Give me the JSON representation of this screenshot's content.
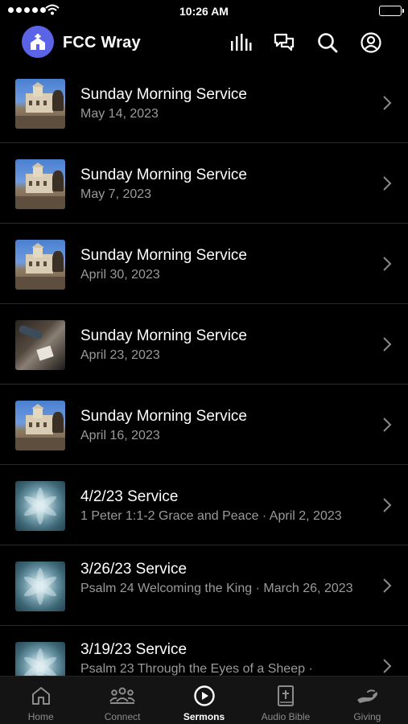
{
  "status_bar": {
    "time": "10:26 AM"
  },
  "header": {
    "app_title": "FCC Wray"
  },
  "sermons": [
    {
      "title": "Sunday Morning Service",
      "subtitle": "May 14, 2023",
      "thumbnail": "church-building-photo"
    },
    {
      "title": "Sunday Morning Service",
      "subtitle": "May 7, 2023",
      "thumbnail": "church-building-photo"
    },
    {
      "title": "Sunday Morning Service",
      "subtitle": "April 30, 2023",
      "thumbnail": "church-building-photo"
    },
    {
      "title": "Sunday Morning Service",
      "subtitle": "April 23, 2023",
      "thumbnail": "people-reading-photo"
    },
    {
      "title": "Sunday Morning Service",
      "subtitle": "April 16, 2023",
      "thumbnail": "church-building-photo"
    },
    {
      "title": "4/2/23 Service",
      "subtitle": "1 Peter 1:1-2 Grace and Peace · April 2, 2023",
      "thumbnail": "succulent-photo"
    },
    {
      "title": "3/26/23 Service",
      "subtitle": "Psalm 24 Welcoming the King · March 26, 2023",
      "thumbnail": "succulent-photo"
    },
    {
      "title": "3/19/23 Service",
      "subtitle": "Psalm 23 Through the Eyes of a Sheep ·",
      "thumbnail": "succulent-photo"
    }
  ],
  "tabs": [
    {
      "label": "Home",
      "icon": "home-icon",
      "active": false
    },
    {
      "label": "Connect",
      "icon": "group-icon",
      "active": false
    },
    {
      "label": "Sermons",
      "icon": "play-circle-icon",
      "active": true
    },
    {
      "label": "Audio Bible",
      "icon": "bible-icon",
      "active": false
    },
    {
      "label": "Giving",
      "icon": "giving-hand-icon",
      "active": false
    }
  ],
  "colors": {
    "accent": "#5b63e6",
    "background": "#000000",
    "muted_text": "#9a9a9a"
  }
}
